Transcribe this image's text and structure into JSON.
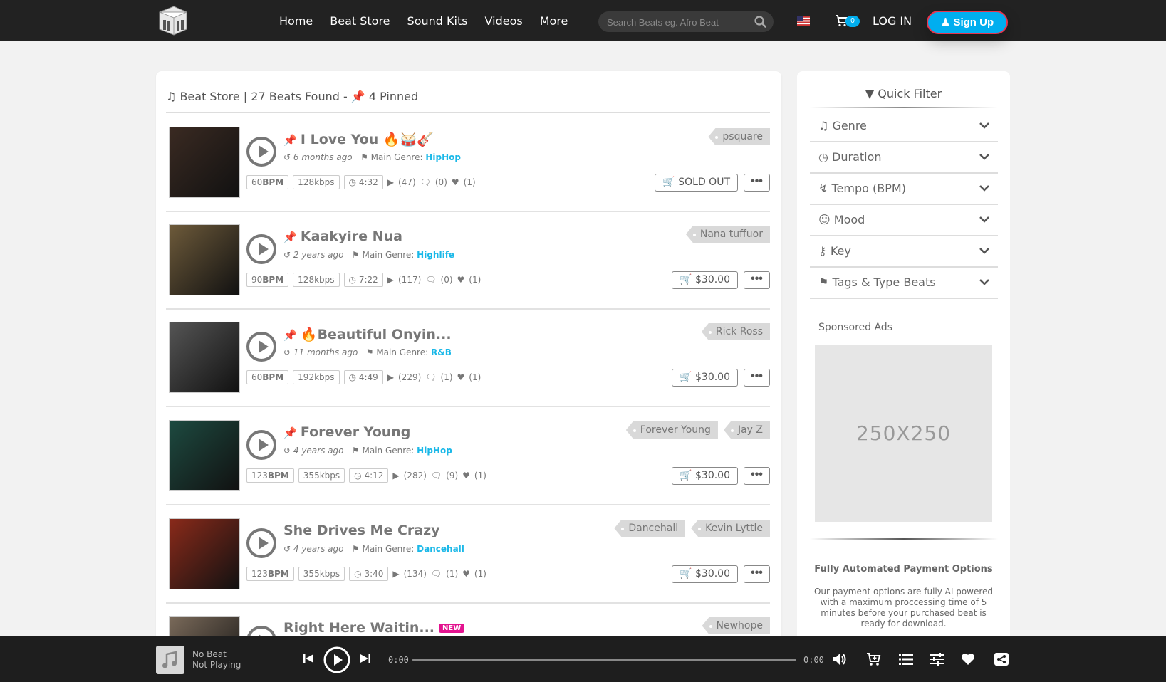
{
  "nav": {
    "items": [
      "Home",
      "Beat Store",
      "Sound Kits",
      "Videos",
      "More"
    ],
    "search_placeholder": "Search Beats eg. Afro Beat",
    "cart_count": "0",
    "login": "LOG IN",
    "signup": "Sign Up"
  },
  "store": {
    "title": "Beat Store | 27 Beats Found - ",
    "pinned": "4 Pinned"
  },
  "beats": [
    {
      "title": "I Love You 🔥🥁🎸",
      "time": "6 months ago",
      "genre_label": "Main Genre:",
      "genre": "HipHop",
      "tags": [
        "psquare"
      ],
      "bpm": "60",
      "kbps": "128kbps",
      "duration": "4:32",
      "plays": "(47)",
      "comments": "(0)",
      "likes": "(1)",
      "price": "SOLD OUT",
      "pinned": true,
      "cover": "#3a2a22"
    },
    {
      "title": "Kaakyire Nua",
      "time": "2 years ago",
      "genre_label": "Main Genre:",
      "genre": "Highlife",
      "tags": [
        "Nana tuffuor"
      ],
      "bpm": "90",
      "kbps": "128kbps",
      "duration": "7:22",
      "plays": "(117)",
      "comments": "(0)",
      "likes": "(1)",
      "price": "$30.00",
      "pinned": true,
      "cover": "#6d5a3a"
    },
    {
      "title": "🔥Beautiful Onyin...",
      "time": "11 months ago",
      "genre_label": "Main Genre:",
      "genre": "R&B",
      "tags": [
        "Rick Ross"
      ],
      "bpm": "60",
      "kbps": "192kbps",
      "duration": "4:49",
      "plays": "(229)",
      "comments": "(1)",
      "likes": "(1)",
      "price": "$30.00",
      "pinned": true,
      "cover": "#555"
    },
    {
      "title": "Forever Young",
      "time": "4 years ago",
      "genre_label": "Main Genre:",
      "genre": "HipHop",
      "tags": [
        "Forever Young",
        "Jay Z"
      ],
      "bpm": "123",
      "kbps": "355kbps",
      "duration": "4:12",
      "plays": "(282)",
      "comments": "(9)",
      "likes": "(1)",
      "price": "$30.00",
      "pinned": true,
      "cover": "#1d4a40"
    },
    {
      "title": "She Drives Me Crazy",
      "time": "4 years ago",
      "genre_label": "Main Genre:",
      "genre": "Dancehall",
      "tags": [
        "Dancehall",
        "Kevin Lyttle"
      ],
      "bpm": "123",
      "kbps": "355kbps",
      "duration": "3:40",
      "plays": "(134)",
      "comments": "(1)",
      "likes": "(1)",
      "price": "$30.00",
      "pinned": false,
      "cover": "#8a2a1a"
    },
    {
      "title": "Right Here Waitin...",
      "badge": "NEW",
      "tags": [
        "Newhope"
      ],
      "cover": "#7a6a5a"
    }
  ],
  "sidebar": {
    "title": "Quick Filter",
    "filters": [
      "Genre",
      "Duration",
      "Tempo (BPM)",
      "Mood",
      "Key",
      "Tags & Type Beats"
    ],
    "sponsored": "Sponsored Ads",
    "ad_text": "250X250",
    "pay_title": "Fully Automated Payment Options",
    "pay_text": "Our payment options are fully AI powered with a maximum proccessing time of 5 minutes before your purchased beat is ready for download."
  },
  "player": {
    "name": "No Beat",
    "status": "Not Playing",
    "time_current": "0:00",
    "time_total": "0:00",
    "progress": 0
  },
  "bpm_label": "BPM",
  "colors": {
    "accent": "#00aeef",
    "genre": "#1ab8e8",
    "new_badge": "#e3138f",
    "topbar": "#222222"
  }
}
